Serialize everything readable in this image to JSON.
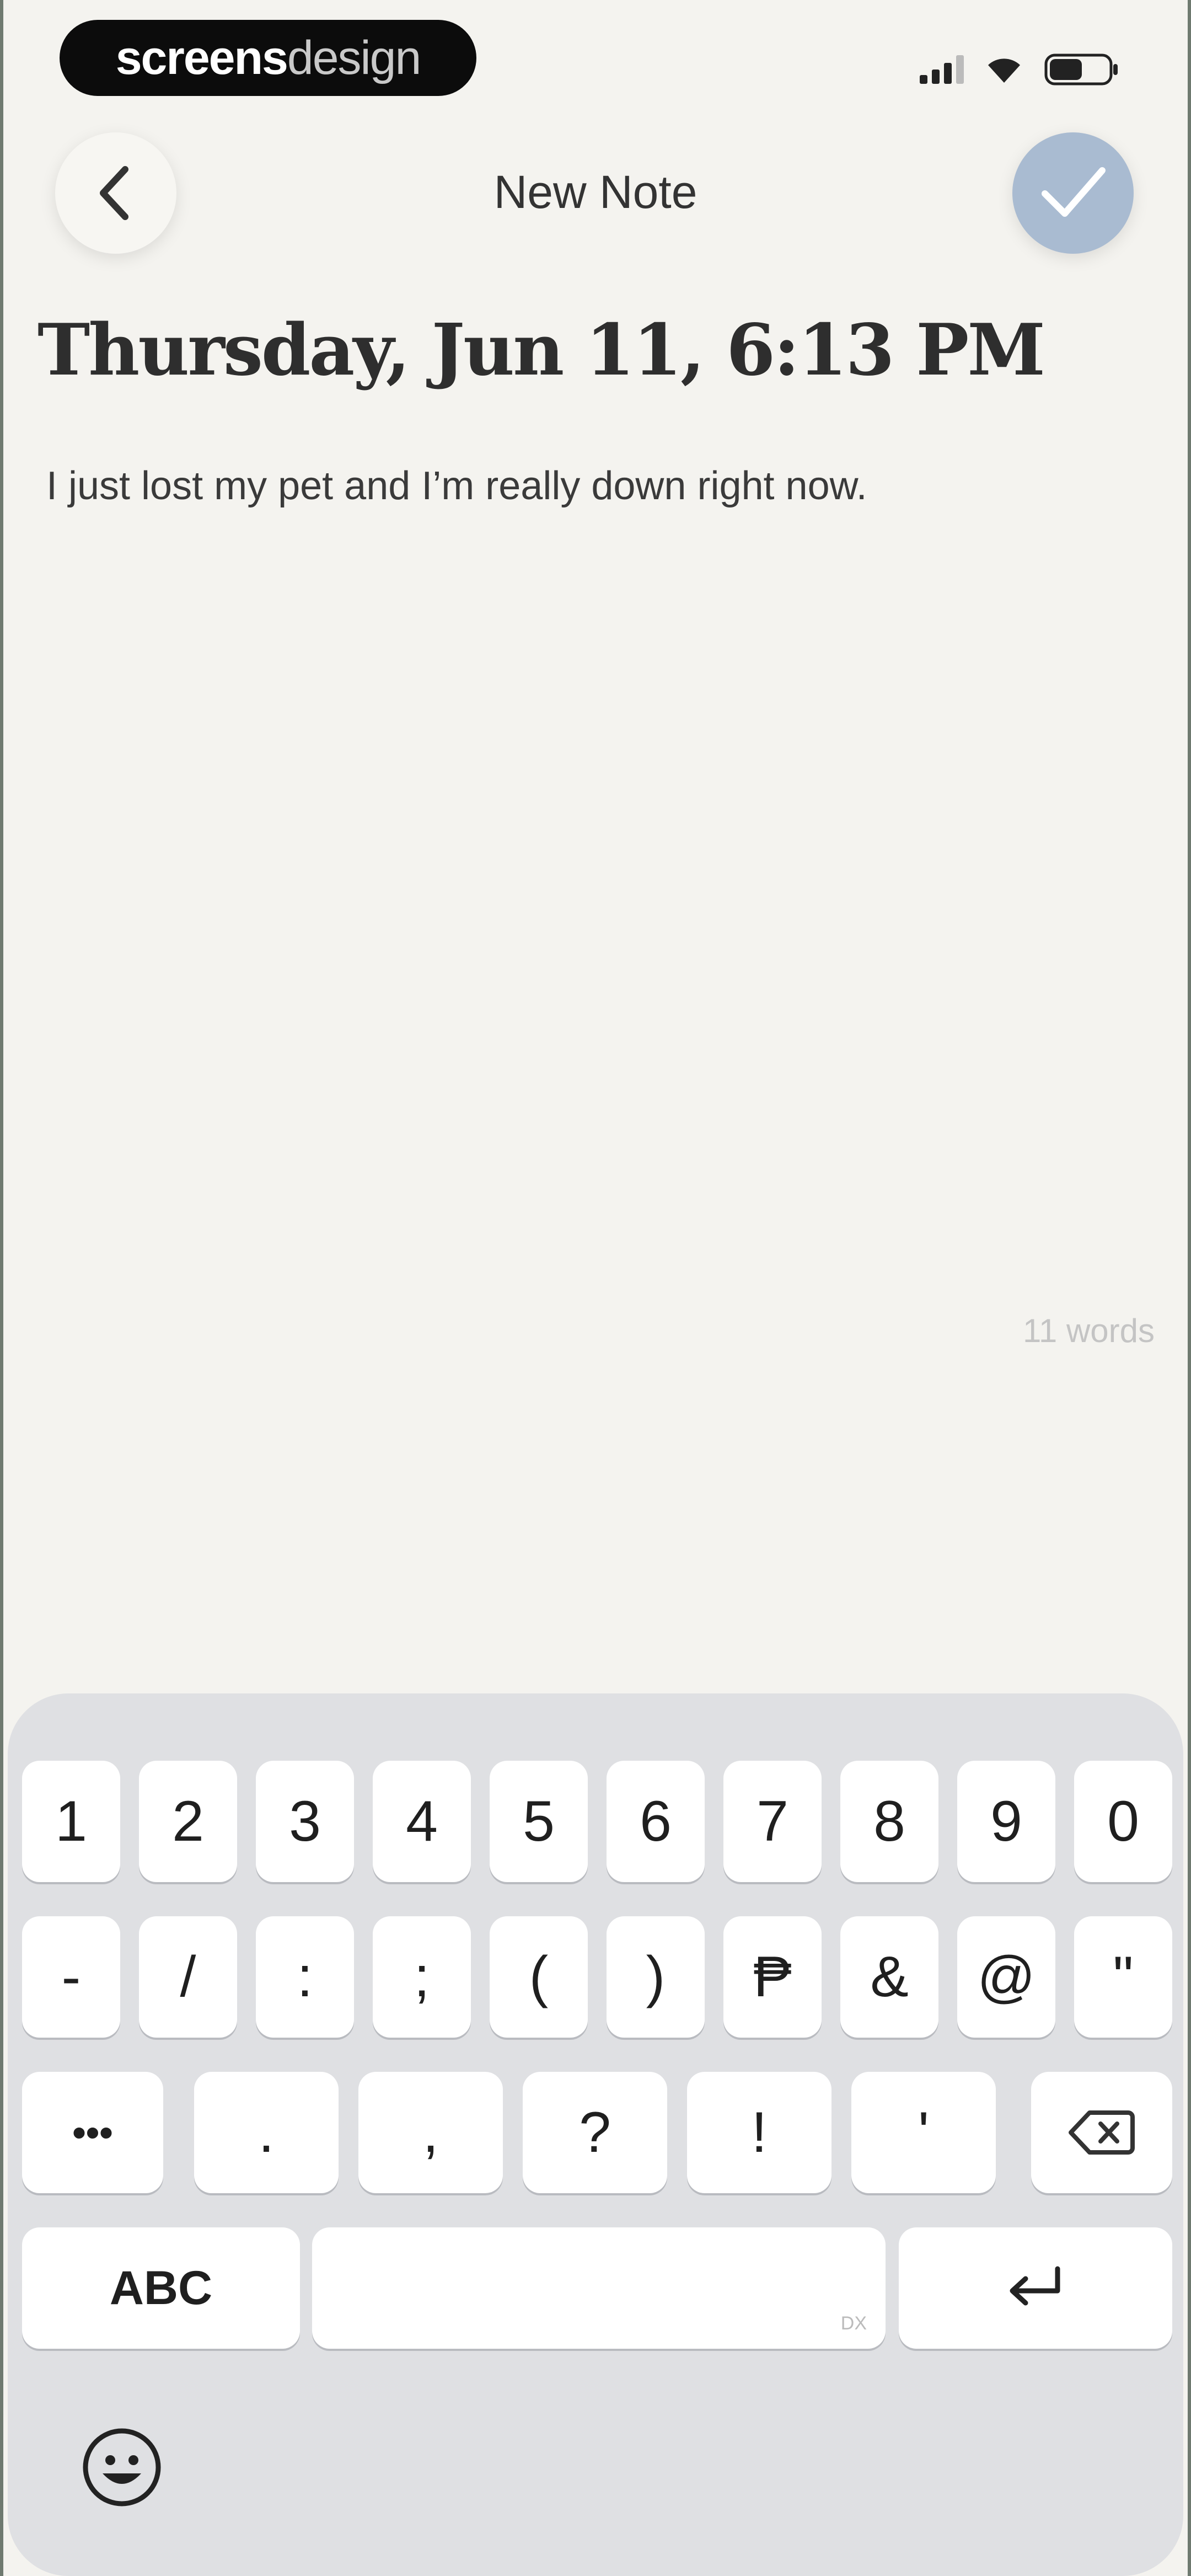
{
  "status_bar": {
    "brand_bold": "screens",
    "brand_light": "design"
  },
  "nav": {
    "title": "New Note",
    "back_icon": "chevron-left-icon",
    "done_icon": "checkmark-icon"
  },
  "note": {
    "date": "Thursday, Jun 11, 6:13 PM",
    "body": "I just lost my pet and I’m really down right now.",
    "word_count": "11 words"
  },
  "keyboard": {
    "row1": [
      "1",
      "2",
      "3",
      "4",
      "5",
      "6",
      "7",
      "8",
      "9",
      "0"
    ],
    "row2": [
      "-",
      "/",
      ":",
      ";",
      "(",
      ")",
      "₱",
      "&",
      "@",
      "\""
    ],
    "row3": [
      ".",
      ",",
      "?",
      "!",
      "'"
    ],
    "row3_left": "•••",
    "abc": "ABC",
    "space_sub": "DX",
    "delete_icon": "backspace-icon",
    "return_icon": "return-icon",
    "emoji_icon": "emoji-face-icon"
  },
  "colors": {
    "background": "#f4f3ef",
    "done_button": "#a9bbd1",
    "keyboard": "#dfe0e3"
  }
}
